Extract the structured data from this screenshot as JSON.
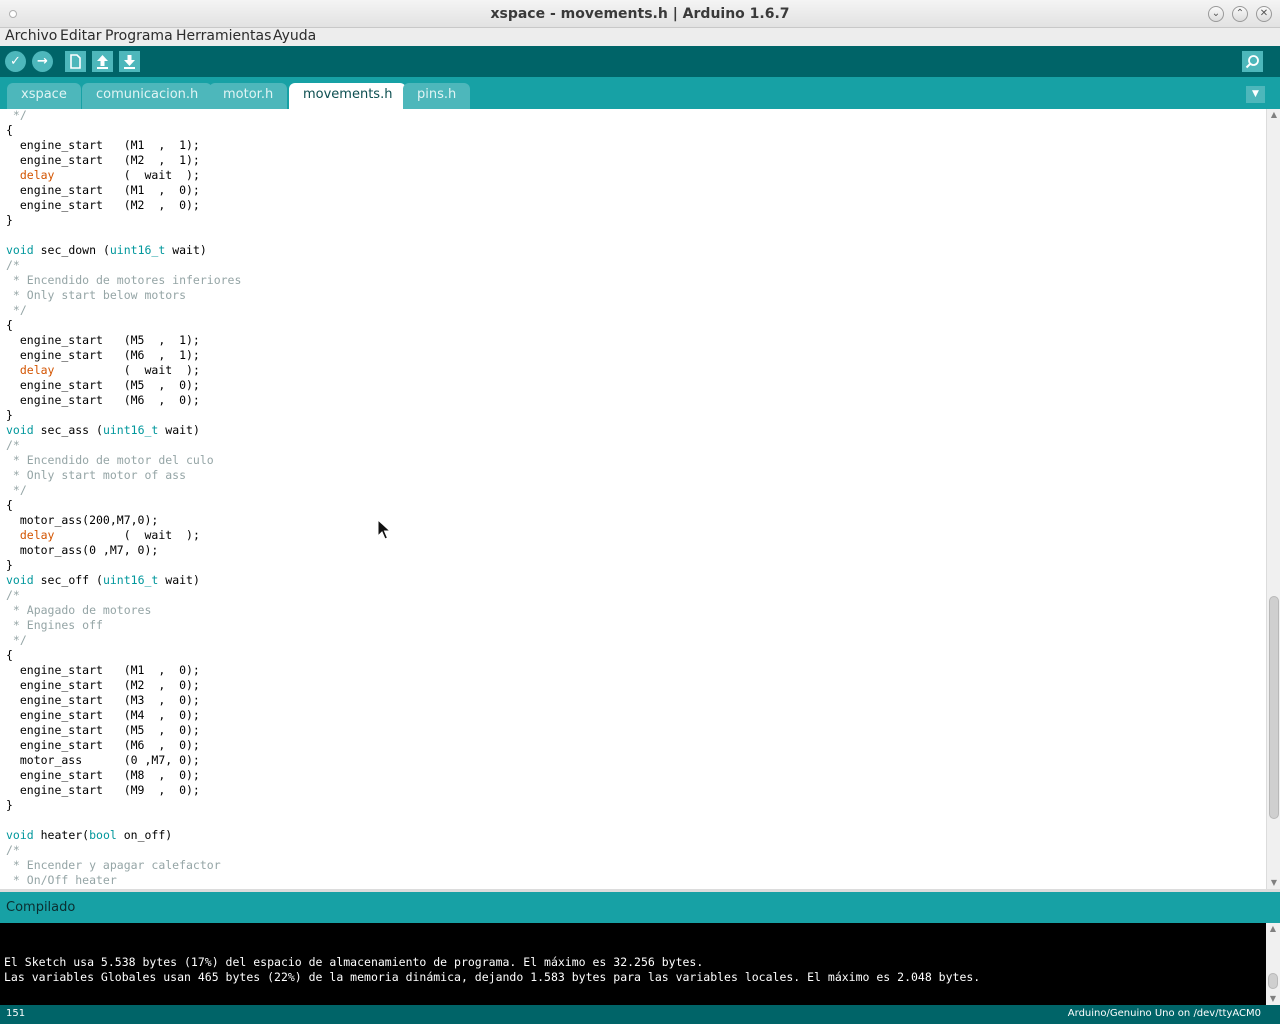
{
  "window": {
    "title": "xspace - movements.h | Arduino 1.6.7"
  },
  "menu": [
    "Archivo",
    "Editar",
    "Programa",
    "Herramientas",
    "Ayuda"
  ],
  "toolbar": {
    "verify_icon": "✓",
    "upload_icon": "→"
  },
  "tabs": [
    "xspace",
    "comunicacion.h",
    "motor.h",
    "movements.h",
    "pins.h"
  ],
  "active_tab": "movements.h",
  "colors": {
    "toolbar_bg": "#006468",
    "tabstrip_bg": "#17a1a5",
    "keyword": "#00979c",
    "function": "#d35400",
    "comment": "#95a5a6"
  },
  "code_lines": [
    [
      [
        "cm",
        " */"
      ]
    ],
    [
      [
        "tx",
        "{"
      ]
    ],
    [
      [
        "tx",
        "  engine_start   (M1  ,  1);"
      ]
    ],
    [
      [
        "tx",
        "  engine_start   (M2  ,  1);"
      ]
    ],
    [
      [
        "tx",
        "  "
      ],
      [
        "fn",
        "delay"
      ],
      [
        "tx",
        "          (  wait  );"
      ]
    ],
    [
      [
        "tx",
        "  engine_start   (M1  ,  0);"
      ]
    ],
    [
      [
        "tx",
        "  engine_start   (M2  ,  0);"
      ]
    ],
    [
      [
        "tx",
        "}"
      ]
    ],
    [],
    [
      [
        "kw",
        "void"
      ],
      [
        "tx",
        " sec_down ("
      ],
      [
        "kw",
        "uint16_t"
      ],
      [
        "tx",
        " wait)"
      ]
    ],
    [
      [
        "cm",
        "/*"
      ]
    ],
    [
      [
        "cm",
        " * Encendido de motores inferiores"
      ]
    ],
    [
      [
        "cm",
        " * Only start below motors"
      ]
    ],
    [
      [
        "cm",
        " */"
      ]
    ],
    [
      [
        "tx",
        "{"
      ]
    ],
    [
      [
        "tx",
        "  engine_start   (M5  ,  1);"
      ]
    ],
    [
      [
        "tx",
        "  engine_start   (M6  ,  1);"
      ]
    ],
    [
      [
        "tx",
        "  "
      ],
      [
        "fn",
        "delay"
      ],
      [
        "tx",
        "          (  wait  );"
      ]
    ],
    [
      [
        "tx",
        "  engine_start   (M5  ,  0);"
      ]
    ],
    [
      [
        "tx",
        "  engine_start   (M6  ,  0);"
      ]
    ],
    [
      [
        "tx",
        "}"
      ]
    ],
    [
      [
        "kw",
        "void"
      ],
      [
        "tx",
        " sec_ass ("
      ],
      [
        "kw",
        "uint16_t"
      ],
      [
        "tx",
        " wait)"
      ]
    ],
    [
      [
        "cm",
        "/*"
      ]
    ],
    [
      [
        "cm",
        " * Encendido de motor del culo"
      ]
    ],
    [
      [
        "cm",
        " * Only start motor of ass"
      ]
    ],
    [
      [
        "cm",
        " */"
      ]
    ],
    [
      [
        "tx",
        "{"
      ]
    ],
    [
      [
        "tx",
        "  motor_ass(200,M7,0);"
      ]
    ],
    [
      [
        "tx",
        "  "
      ],
      [
        "fn",
        "delay"
      ],
      [
        "tx",
        "          (  wait  );"
      ]
    ],
    [
      [
        "tx",
        "  motor_ass(0 ,M7, 0);"
      ]
    ],
    [
      [
        "tx",
        "}"
      ]
    ],
    [
      [
        "kw",
        "void"
      ],
      [
        "tx",
        " sec_off ("
      ],
      [
        "kw",
        "uint16_t"
      ],
      [
        "tx",
        " wait)"
      ]
    ],
    [
      [
        "cm",
        "/*"
      ]
    ],
    [
      [
        "cm",
        " * Apagado de motores"
      ]
    ],
    [
      [
        "cm",
        " * Engines off"
      ]
    ],
    [
      [
        "cm",
        " */"
      ]
    ],
    [
      [
        "tx",
        "{"
      ]
    ],
    [
      [
        "tx",
        "  engine_start   (M1  ,  0);"
      ]
    ],
    [
      [
        "tx",
        "  engine_start   (M2  ,  0);"
      ]
    ],
    [
      [
        "tx",
        "  engine_start   (M3  ,  0);"
      ]
    ],
    [
      [
        "tx",
        "  engine_start   (M4  ,  0);"
      ]
    ],
    [
      [
        "tx",
        "  engine_start   (M5  ,  0);"
      ]
    ],
    [
      [
        "tx",
        "  engine_start   (M6  ,  0);"
      ]
    ],
    [
      [
        "tx",
        "  motor_ass      (0 ,M7, 0);"
      ]
    ],
    [
      [
        "tx",
        "  engine_start   (M8  ,  0);"
      ]
    ],
    [
      [
        "tx",
        "  engine_start   (M9  ,  0);"
      ]
    ],
    [
      [
        "tx",
        "}"
      ]
    ],
    [],
    [
      [
        "kw",
        "void"
      ],
      [
        "tx",
        " heater("
      ],
      [
        "kw",
        "bool"
      ],
      [
        "tx",
        " on_off)"
      ]
    ],
    [
      [
        "cm",
        "/*"
      ]
    ],
    [
      [
        "cm",
        " * Encender y apagar calefactor"
      ]
    ],
    [
      [
        "cm",
        " * On/Off heater"
      ]
    ]
  ],
  "status": {
    "message": "Compilado"
  },
  "console_lines": [
    "El Sketch usa 5.538 bytes (17%) del espacio de almacenamiento de programa. El máximo es 32.256 bytes.",
    "Las variables Globales usan 465 bytes (22%) de la memoria dinámica, dejando 1.583 bytes para las variables locales. El máximo es 2.048 bytes."
  ],
  "footer": {
    "line_number": "151",
    "board": "Arduino/Genuino Uno on /dev/ttyACM0"
  }
}
